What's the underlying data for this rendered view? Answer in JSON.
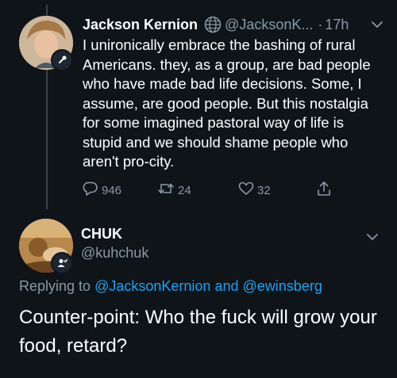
{
  "tweet": {
    "author_name": "Jackson Kernion",
    "author_handle": "@JacksonK...",
    "time_separator": "·",
    "time": "17h",
    "text": "I unironically embrace the bashing of rural Americans. they, as a group, are bad people who have made bad life decisions. Some, I assume, are good people. But this nostalgia for some imagined pastoral way of life is stupid and we should shame people who aren't pro-city.",
    "actions": {
      "reply_count": "946",
      "retweet_count": "24",
      "like_count": "32"
    }
  },
  "reply": {
    "author_name": "CHUK",
    "author_handle": "@kuhchuk",
    "replying_prefix": "Replying to",
    "replying_to_1": "@JacksonKernion",
    "replying_and": "and",
    "replying_to_2": "@ewinsberg",
    "text": "Counter-point:  Who the fuck will grow your food, retard?"
  },
  "colors": {
    "background": "#0f1419",
    "primary_text": "#ffffff",
    "secondary_text": "#8899a6",
    "link": "#1da1f2",
    "thread_line": "#38444d"
  },
  "icons": [
    "globe-icon",
    "chevron-down-icon",
    "reply-icon",
    "retweet-icon",
    "like-icon",
    "share-icon",
    "microphone-badge-icon",
    "follow-badge-icon"
  ]
}
